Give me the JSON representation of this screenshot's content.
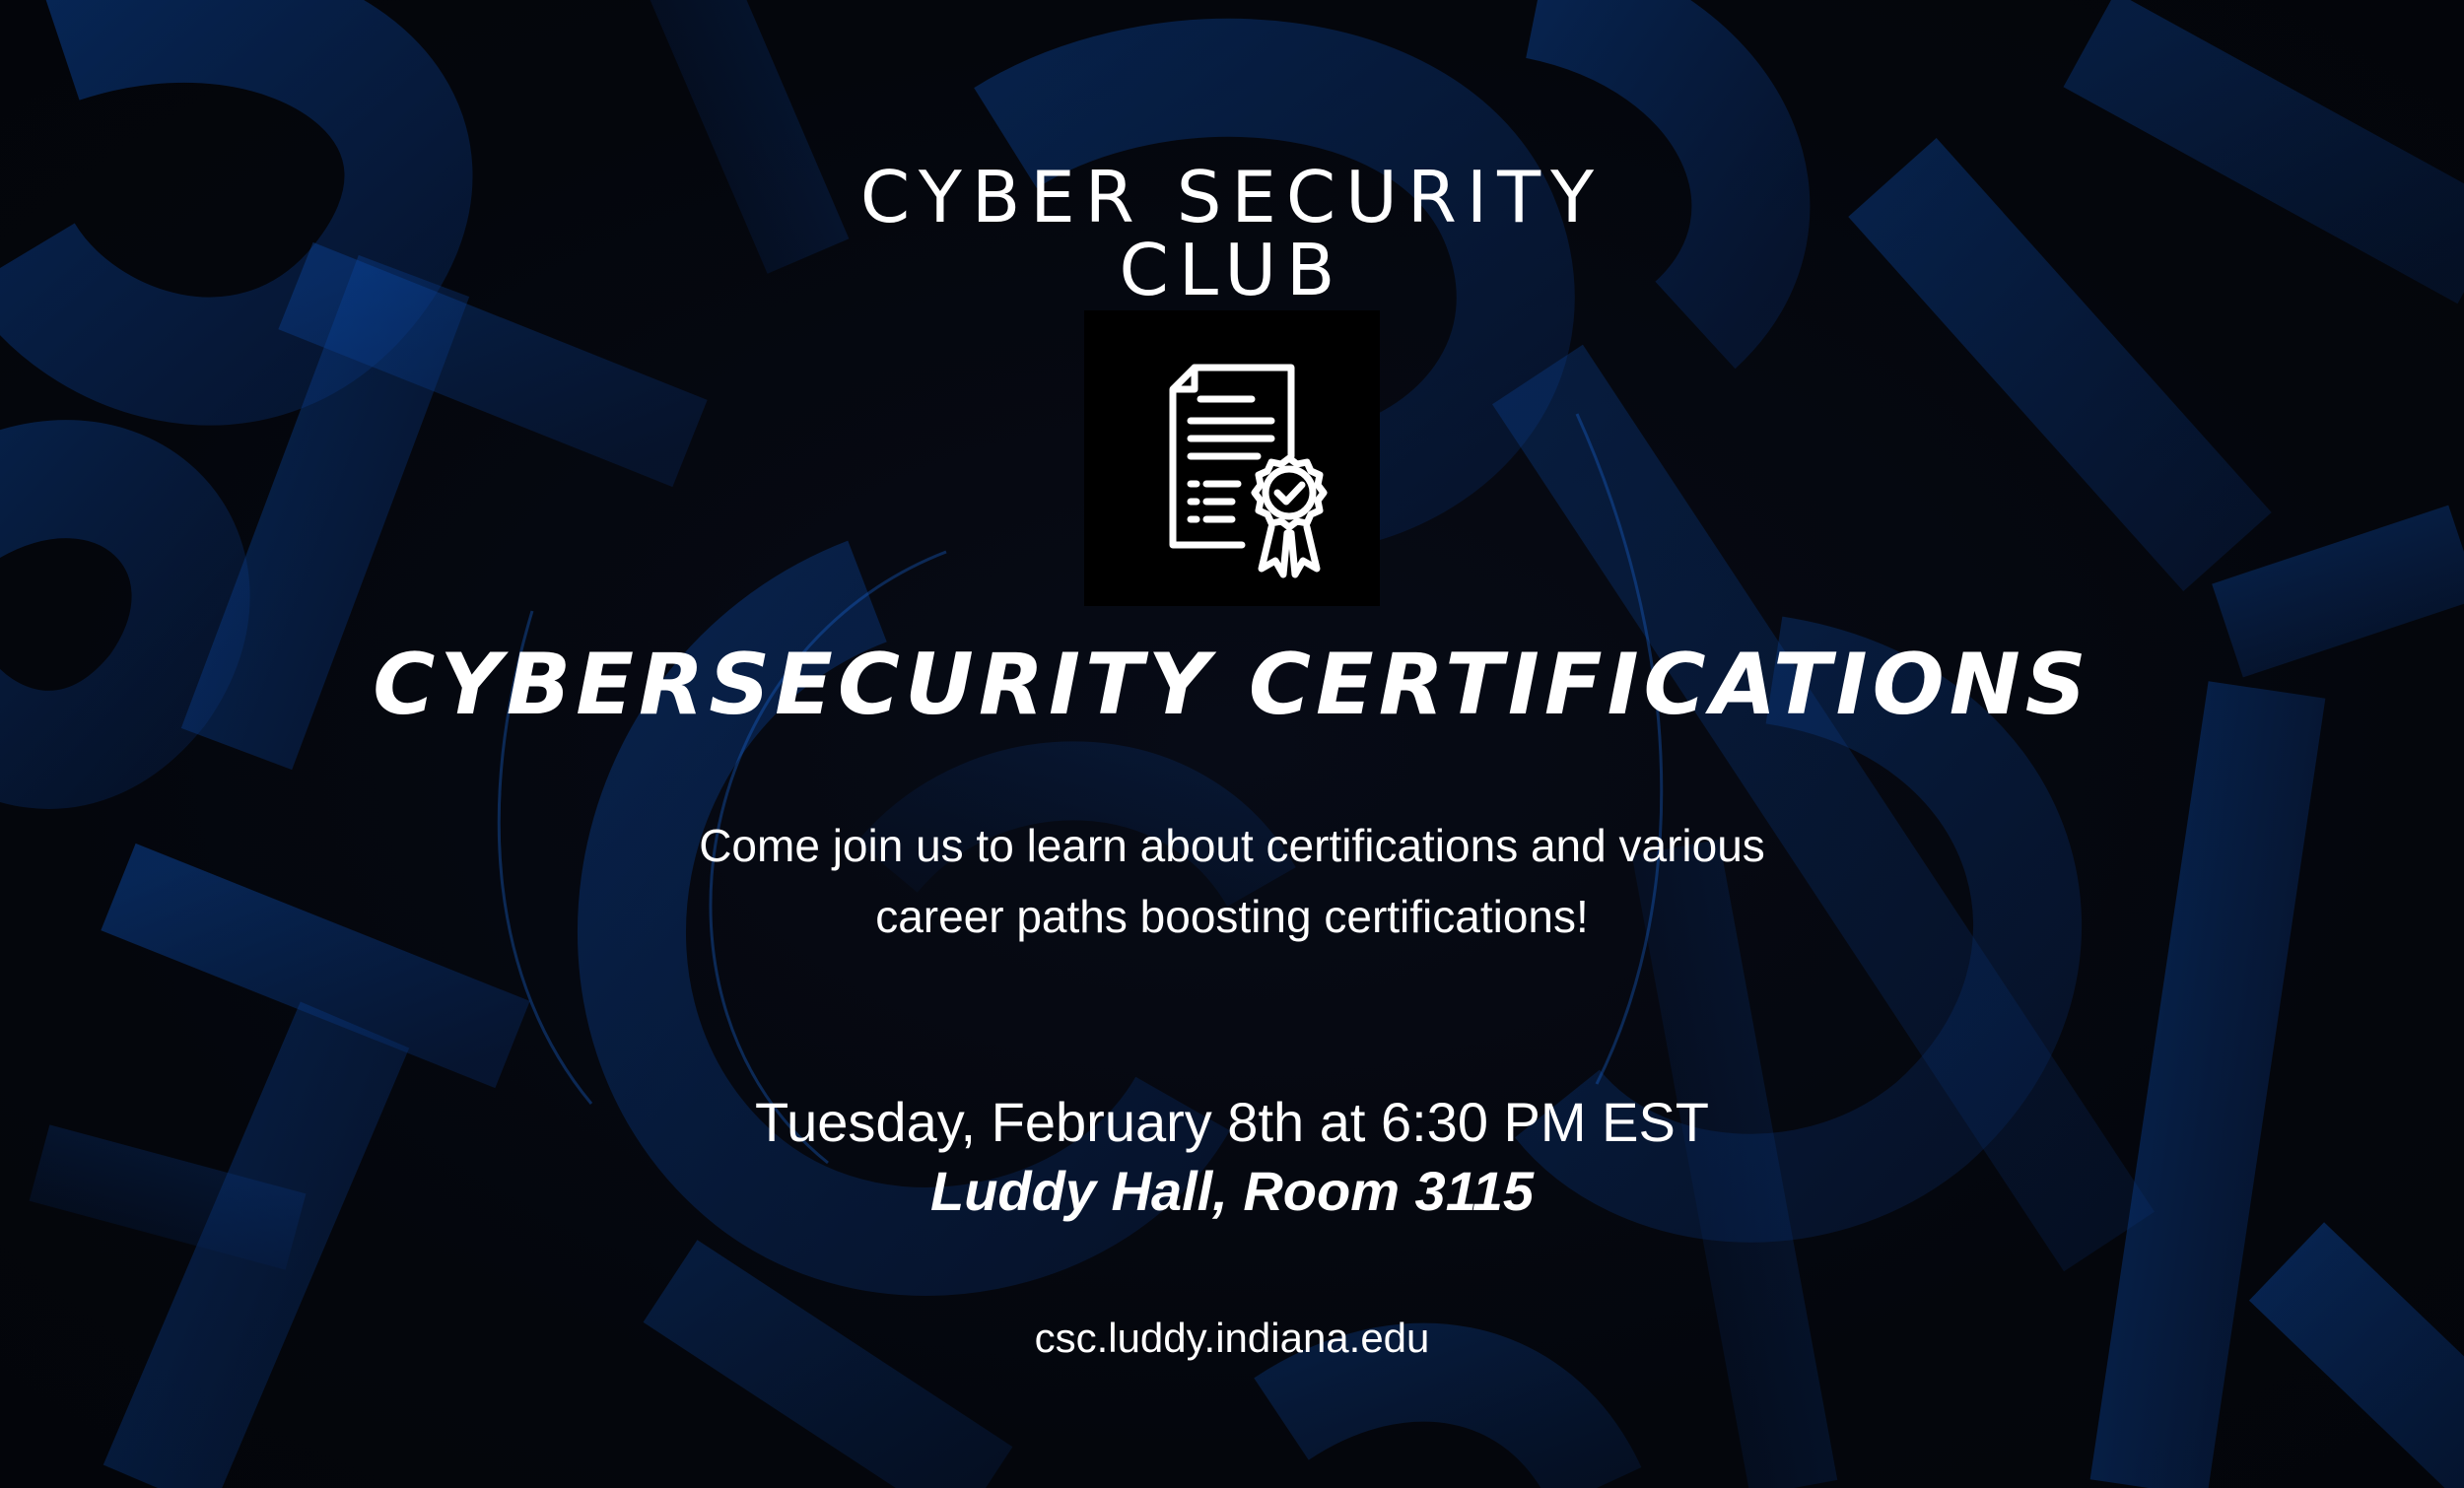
{
  "club": {
    "name_line1": "CYBER SECURITY",
    "name_line2": "CLUB"
  },
  "icon": {
    "name": "certificate-icon",
    "color": "#ffffff",
    "box_color": "#000000"
  },
  "event": {
    "title": "CYBERSECURITY CERTIFICATIONS",
    "description_line1": "Come join us to learn about certifications and various",
    "description_line2": "career paths boosting certifications!",
    "datetime": "Tuesday, February 8th at 6:30 PM EST",
    "location": "Luddy Hall, Room 3115"
  },
  "website": "csc.luddy.indiana.edu",
  "colors": {
    "background": "#05070d",
    "accent_blue": "#0a3d8f",
    "text": "#ffffff"
  }
}
